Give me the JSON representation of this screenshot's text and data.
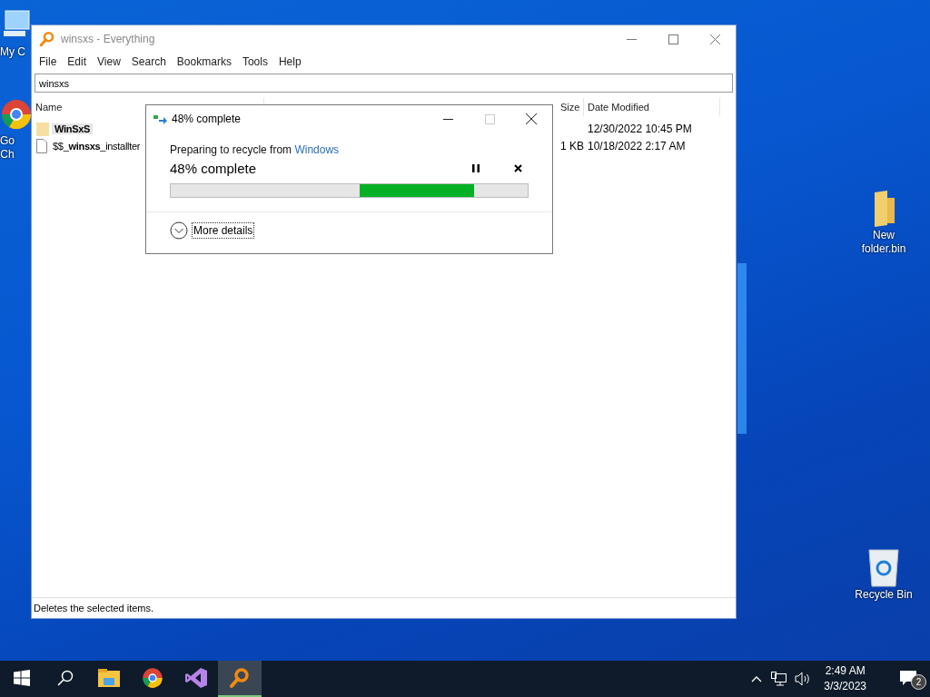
{
  "desktop_icons": [
    {
      "label": "My C",
      "kind": "computer"
    },
    {
      "label": "Go\nCh",
      "kind": "chrome"
    },
    {
      "label": "New\nfolder.bin",
      "kind": "folder"
    },
    {
      "label": "Recycle Bin",
      "kind": "recycle"
    }
  ],
  "window": {
    "title": "winsxs - Everything",
    "menu": [
      "File",
      "Edit",
      "View",
      "Search",
      "Bookmarks",
      "Tools",
      "Help"
    ],
    "search": {
      "value": "winsxs"
    },
    "columns": [
      "Name",
      "Size",
      "Date Modified"
    ],
    "rows": [
      {
        "kind": "folder",
        "name": "WinSxS",
        "size": "",
        "date": "12/30/2022 10:45 PM",
        "selected": true
      },
      {
        "kind": "file",
        "name": "$$_**winsxs**_installter",
        "size": "1 KB",
        "date": "10/18/2022 2:17 AM",
        "selected": false
      }
    ],
    "status_bar": "Deletes the selected items."
  },
  "dialog": {
    "title": "48% complete",
    "message": "Preparing to recycle from ",
    "source": "Windows",
    "progress_text": "48% complete",
    "progress": {
      "kind": "marquee"
    },
    "details_button": "More details"
  },
  "taskbar": {
    "apps": [
      {
        "kind": "explorer",
        "selected": false
      },
      {
        "kind": "chrome",
        "selected": false
      },
      {
        "kind": "vs",
        "selected": false
      },
      {
        "kind": "everything",
        "selected": true
      }
    ],
    "time": "2:49 AM",
    "date": "3/3/2023",
    "notifications": "2"
  }
}
